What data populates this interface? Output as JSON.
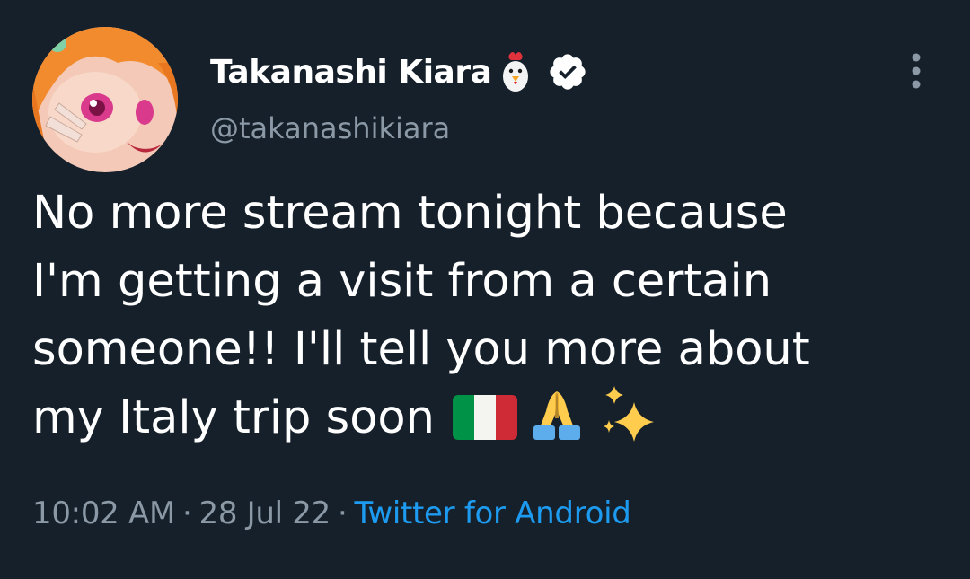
{
  "author": {
    "display_name": "Takanashi Kiara",
    "handle": "@takanashikiara",
    "name_emoji_icon": "chicken-icon",
    "verified_icon": "verified-badge-icon",
    "avatar": "profile-avatar"
  },
  "menu_icon": "more-options-icon",
  "tweet": {
    "lines": [
      "No more stream tonight because",
      "I'm getting a visit from a certain",
      "someone!! I'll tell you more about",
      "my Italy trip soon"
    ],
    "emojis": [
      "italy-flag-icon",
      "folded-hands-icon",
      "sparkles-icon"
    ]
  },
  "meta": {
    "time": "10:02 AM",
    "separator": "·",
    "date": "28 Jul 22",
    "source": "Twitter for Android"
  },
  "colors": {
    "background": "#15202b",
    "text": "#ffffff",
    "secondary_text": "#8b98a5",
    "link": "#1d9bf0",
    "divider": "#38444d"
  }
}
